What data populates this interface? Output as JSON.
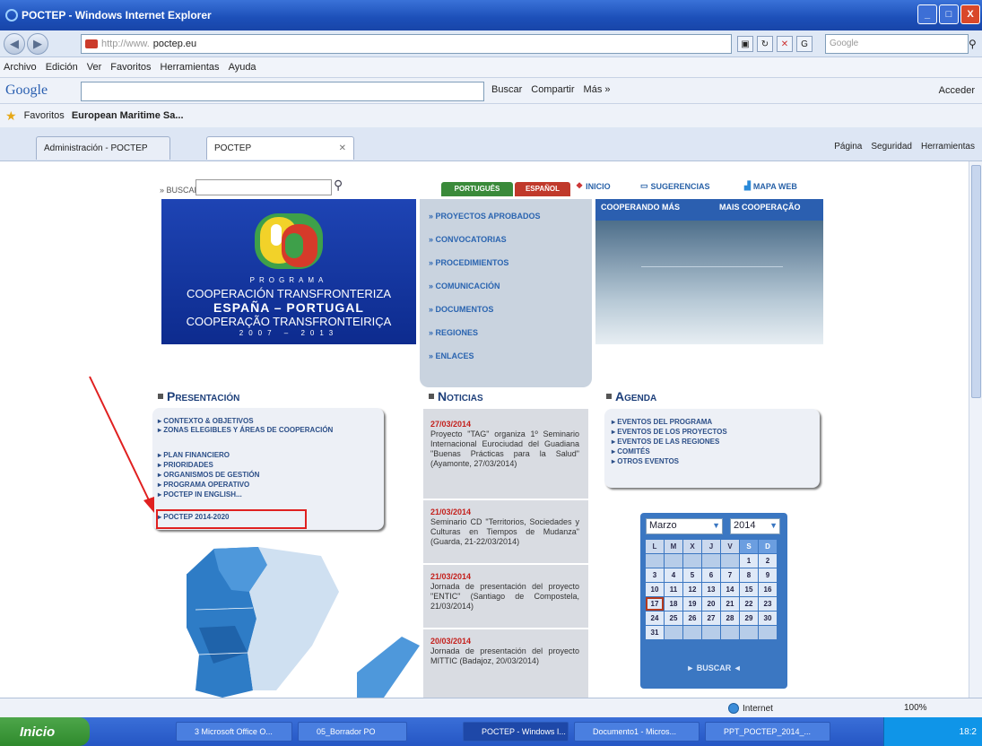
{
  "window": {
    "title": "POCTEP - Windows Internet Explorer",
    "controls": [
      "_",
      "□",
      "X"
    ]
  },
  "address_bar": {
    "protocol": "http://www.",
    "url": "poctep.eu",
    "search_placeholder": "Google"
  },
  "menu": [
    "Archivo",
    "Edición",
    "Ver",
    "Favoritos",
    "Herramientas",
    "Ayuda"
  ],
  "google_toolbar": {
    "logo": "Google",
    "buscar": "Buscar",
    "compartir": "Compartir",
    "mas": "Más »",
    "acceder": "Acceder"
  },
  "favorites": {
    "label": "Favoritos",
    "item": "European Maritime Sa..."
  },
  "tabs": [
    {
      "label": "Administración - POCTEP",
      "active": false
    },
    {
      "label": "POCTEP",
      "active": true
    }
  ],
  "command_bar": [
    "Página",
    "Seguridad",
    "Herramientas"
  ],
  "site": {
    "search_label": "» BUSCAR",
    "lang_pt": "PORTUGUÊS",
    "lang_es": "ESPAÑOL",
    "links": [
      "INICIO",
      "SUGERENCIAS",
      "MAPA WEB"
    ],
    "banner": {
      "programa": "PROGRAMA",
      "line1": "COOPERACIÓN TRANSFRONTERIZA",
      "line2": "ESPAÑA – PORTUGAL",
      "line3": "COOPERAÇÃO TRANSFRONTEIRIÇA",
      "years": "2007 – 2013"
    },
    "main_menu": [
      "» PROYECTOS APROBADOS",
      "» CONVOCATORIAS",
      "» PROCEDIMIENTOS",
      "» COMUNICACIÓN",
      "» DOCUMENTOS",
      "» REGIONES",
      "» ENLACES"
    ],
    "promo": {
      "left": "COOPERANDO MÁS",
      "right": "MAIS COOPERAÇÃO"
    },
    "presentacion": {
      "title": "Presentación",
      "items": [
        "CONTEXTO & OBJETIVOS",
        "ZONAS ELEGIBLES Y ÁREAS DE COOPERACIÓN",
        "PLAN FINANCIERO",
        "PRIORIDADES",
        "ORGANISMOS DE GESTIÓN",
        "PROGRAMA OPERATIVO",
        "POCTEP IN ENGLISH...",
        "POCTEP 2014-2020"
      ]
    },
    "noticias": {
      "title": "Noticias",
      "items": [
        {
          "date": "27/03/2014",
          "text": "Proyecto \"TAG\" organiza 1º Seminario Internacional Eurociudad del Guadiana \"Buenas Prácticas para la Salud\" (Ayamonte, 27/03/2014)"
        },
        {
          "date": "21/03/2014",
          "text": "Seminario CD \"Territorios, Sociedades y Culturas en Tiempos de Mudanza\" (Guarda, 21-22/03/2014)"
        },
        {
          "date": "21/03/2014",
          "text": "Jornada de presentación del proyecto \"ENTIC\" (Santiago de Compostela, 21/03/2014)"
        },
        {
          "date": "20/03/2014",
          "text": "Jornada de presentación del proyecto MITTIC (Badajoz, 20/03/2014)"
        }
      ]
    },
    "agenda": {
      "title": "Agenda",
      "items": [
        "EVENTOS DEL PROGRAMA",
        "EVENTOS DE LOS PROYECTOS",
        "EVENTOS DE LAS REGIONES",
        "COMITÉS",
        "OTROS EVENTOS"
      ]
    },
    "calendar": {
      "month": "Marzo",
      "year": "2014",
      "headers": [
        "L",
        "M",
        "X",
        "J",
        "V",
        "S",
        "D"
      ],
      "weeks": [
        [
          "",
          "",
          "",
          "",
          "",
          "1",
          "2"
        ],
        [
          "3",
          "4",
          "5",
          "6",
          "7",
          "8",
          "9"
        ],
        [
          "10",
          "11",
          "12",
          "13",
          "14",
          "15",
          "16"
        ],
        [
          "17",
          "18",
          "19",
          "20",
          "21",
          "22",
          "23"
        ],
        [
          "24",
          "25",
          "26",
          "27",
          "28",
          "29",
          "30"
        ],
        [
          "31",
          "",
          "",
          "",
          "",
          "",
          ""
        ]
      ],
      "today": "17",
      "button": "► BUSCAR ◄"
    }
  },
  "status": {
    "zone": "Internet",
    "zoom": "100%"
  },
  "taskbar": {
    "start": "Inicio",
    "items": [
      "3 Microsoft Office O...",
      "05_Borrador PO",
      "POCTEP - Windows I...",
      "Documento1 - Micros...",
      "PPT_POCTEP_2014_..."
    ],
    "clock": "18:2"
  },
  "colors": {
    "annotation_red": "#e02020",
    "banner_blue": "#1e44b4",
    "news_date_red": "#c4201c"
  }
}
